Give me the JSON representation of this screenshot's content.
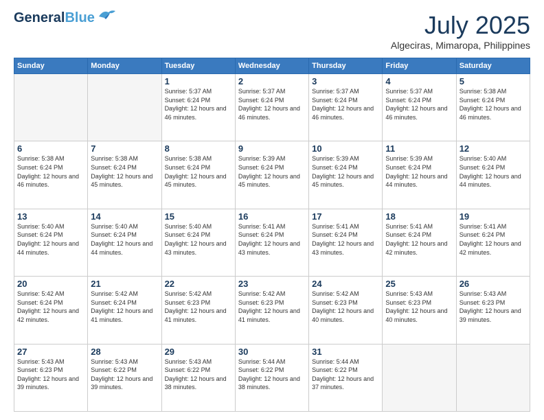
{
  "header": {
    "logo_line1": "General",
    "logo_line2": "Blue",
    "month": "July 2025",
    "location": "Algeciras, Mimaropa, Philippines"
  },
  "days_of_week": [
    "Sunday",
    "Monday",
    "Tuesday",
    "Wednesday",
    "Thursday",
    "Friday",
    "Saturday"
  ],
  "weeks": [
    [
      {
        "day": "",
        "sunrise": "",
        "sunset": "",
        "daylight": "",
        "empty": true
      },
      {
        "day": "",
        "sunrise": "",
        "sunset": "",
        "daylight": "",
        "empty": true
      },
      {
        "day": "1",
        "sunrise": "Sunrise: 5:37 AM",
        "sunset": "Sunset: 6:24 PM",
        "daylight": "Daylight: 12 hours and 46 minutes.",
        "empty": false
      },
      {
        "day": "2",
        "sunrise": "Sunrise: 5:37 AM",
        "sunset": "Sunset: 6:24 PM",
        "daylight": "Daylight: 12 hours and 46 minutes.",
        "empty": false
      },
      {
        "day": "3",
        "sunrise": "Sunrise: 5:37 AM",
        "sunset": "Sunset: 6:24 PM",
        "daylight": "Daylight: 12 hours and 46 minutes.",
        "empty": false
      },
      {
        "day": "4",
        "sunrise": "Sunrise: 5:37 AM",
        "sunset": "Sunset: 6:24 PM",
        "daylight": "Daylight: 12 hours and 46 minutes.",
        "empty": false
      },
      {
        "day": "5",
        "sunrise": "Sunrise: 5:38 AM",
        "sunset": "Sunset: 6:24 PM",
        "daylight": "Daylight: 12 hours and 46 minutes.",
        "empty": false
      }
    ],
    [
      {
        "day": "6",
        "sunrise": "Sunrise: 5:38 AM",
        "sunset": "Sunset: 6:24 PM",
        "daylight": "Daylight: 12 hours and 46 minutes.",
        "empty": false
      },
      {
        "day": "7",
        "sunrise": "Sunrise: 5:38 AM",
        "sunset": "Sunset: 6:24 PM",
        "daylight": "Daylight: 12 hours and 45 minutes.",
        "empty": false
      },
      {
        "day": "8",
        "sunrise": "Sunrise: 5:38 AM",
        "sunset": "Sunset: 6:24 PM",
        "daylight": "Daylight: 12 hours and 45 minutes.",
        "empty": false
      },
      {
        "day": "9",
        "sunrise": "Sunrise: 5:39 AM",
        "sunset": "Sunset: 6:24 PM",
        "daylight": "Daylight: 12 hours and 45 minutes.",
        "empty": false
      },
      {
        "day": "10",
        "sunrise": "Sunrise: 5:39 AM",
        "sunset": "Sunset: 6:24 PM",
        "daylight": "Daylight: 12 hours and 45 minutes.",
        "empty": false
      },
      {
        "day": "11",
        "sunrise": "Sunrise: 5:39 AM",
        "sunset": "Sunset: 6:24 PM",
        "daylight": "Daylight: 12 hours and 44 minutes.",
        "empty": false
      },
      {
        "day": "12",
        "sunrise": "Sunrise: 5:40 AM",
        "sunset": "Sunset: 6:24 PM",
        "daylight": "Daylight: 12 hours and 44 minutes.",
        "empty": false
      }
    ],
    [
      {
        "day": "13",
        "sunrise": "Sunrise: 5:40 AM",
        "sunset": "Sunset: 6:24 PM",
        "daylight": "Daylight: 12 hours and 44 minutes.",
        "empty": false
      },
      {
        "day": "14",
        "sunrise": "Sunrise: 5:40 AM",
        "sunset": "Sunset: 6:24 PM",
        "daylight": "Daylight: 12 hours and 44 minutes.",
        "empty": false
      },
      {
        "day": "15",
        "sunrise": "Sunrise: 5:40 AM",
        "sunset": "Sunset: 6:24 PM",
        "daylight": "Daylight: 12 hours and 43 minutes.",
        "empty": false
      },
      {
        "day": "16",
        "sunrise": "Sunrise: 5:41 AM",
        "sunset": "Sunset: 6:24 PM",
        "daylight": "Daylight: 12 hours and 43 minutes.",
        "empty": false
      },
      {
        "day": "17",
        "sunrise": "Sunrise: 5:41 AM",
        "sunset": "Sunset: 6:24 PM",
        "daylight": "Daylight: 12 hours and 43 minutes.",
        "empty": false
      },
      {
        "day": "18",
        "sunrise": "Sunrise: 5:41 AM",
        "sunset": "Sunset: 6:24 PM",
        "daylight": "Daylight: 12 hours and 42 minutes.",
        "empty": false
      },
      {
        "day": "19",
        "sunrise": "Sunrise: 5:41 AM",
        "sunset": "Sunset: 6:24 PM",
        "daylight": "Daylight: 12 hours and 42 minutes.",
        "empty": false
      }
    ],
    [
      {
        "day": "20",
        "sunrise": "Sunrise: 5:42 AM",
        "sunset": "Sunset: 6:24 PM",
        "daylight": "Daylight: 12 hours and 42 minutes.",
        "empty": false
      },
      {
        "day": "21",
        "sunrise": "Sunrise: 5:42 AM",
        "sunset": "Sunset: 6:24 PM",
        "daylight": "Daylight: 12 hours and 41 minutes.",
        "empty": false
      },
      {
        "day": "22",
        "sunrise": "Sunrise: 5:42 AM",
        "sunset": "Sunset: 6:23 PM",
        "daylight": "Daylight: 12 hours and 41 minutes.",
        "empty": false
      },
      {
        "day": "23",
        "sunrise": "Sunrise: 5:42 AM",
        "sunset": "Sunset: 6:23 PM",
        "daylight": "Daylight: 12 hours and 41 minutes.",
        "empty": false
      },
      {
        "day": "24",
        "sunrise": "Sunrise: 5:42 AM",
        "sunset": "Sunset: 6:23 PM",
        "daylight": "Daylight: 12 hours and 40 minutes.",
        "empty": false
      },
      {
        "day": "25",
        "sunrise": "Sunrise: 5:43 AM",
        "sunset": "Sunset: 6:23 PM",
        "daylight": "Daylight: 12 hours and 40 minutes.",
        "empty": false
      },
      {
        "day": "26",
        "sunrise": "Sunrise: 5:43 AM",
        "sunset": "Sunset: 6:23 PM",
        "daylight": "Daylight: 12 hours and 39 minutes.",
        "empty": false
      }
    ],
    [
      {
        "day": "27",
        "sunrise": "Sunrise: 5:43 AM",
        "sunset": "Sunset: 6:23 PM",
        "daylight": "Daylight: 12 hours and 39 minutes.",
        "empty": false
      },
      {
        "day": "28",
        "sunrise": "Sunrise: 5:43 AM",
        "sunset": "Sunset: 6:22 PM",
        "daylight": "Daylight: 12 hours and 39 minutes.",
        "empty": false
      },
      {
        "day": "29",
        "sunrise": "Sunrise: 5:43 AM",
        "sunset": "Sunset: 6:22 PM",
        "daylight": "Daylight: 12 hours and 38 minutes.",
        "empty": false
      },
      {
        "day": "30",
        "sunrise": "Sunrise: 5:44 AM",
        "sunset": "Sunset: 6:22 PM",
        "daylight": "Daylight: 12 hours and 38 minutes.",
        "empty": false
      },
      {
        "day": "31",
        "sunrise": "Sunrise: 5:44 AM",
        "sunset": "Sunset: 6:22 PM",
        "daylight": "Daylight: 12 hours and 37 minutes.",
        "empty": false
      },
      {
        "day": "",
        "sunrise": "",
        "sunset": "",
        "daylight": "",
        "empty": true
      },
      {
        "day": "",
        "sunrise": "",
        "sunset": "",
        "daylight": "",
        "empty": true
      }
    ]
  ]
}
